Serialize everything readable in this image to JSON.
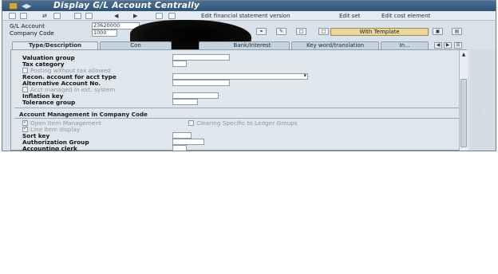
{
  "window": {
    "title": "Display G/L Account Centrally"
  },
  "toolbar": {
    "edit_fs_version": "Edit financial statement version",
    "edit_set": "Edit set",
    "edit_cost_element": "Edit cost element"
  },
  "header": {
    "gl_account_label": "G/L Account",
    "gl_account_value": "23620000",
    "company_code_label": "Company Code",
    "company_code_value": "1000",
    "with_template_label": "With Template"
  },
  "tabs": [
    {
      "label": "Type/Description"
    },
    {
      "label": "Con"
    },
    {
      "label": "Bank/Interest"
    },
    {
      "label": "Key word/translation"
    },
    {
      "label": "In..."
    }
  ],
  "section1": {
    "valuation_group": "Valuation group",
    "tax_category": "Tax category",
    "posting_without_tax": "Posting without tax allowed",
    "recon_account": "Recon. account for acct type",
    "alternative_account": "Alternative Account No.",
    "acct_managed_ext": "Acct managed in ext. system",
    "inflation_key": "Inflation key",
    "tolerance_group": "Tolerance group"
  },
  "section2": {
    "title": "Account Management in Company Code",
    "open_item_mgmt": "Open Item Management",
    "clearing_specific": "Clearing Specific to Ledger Groups",
    "line_item_display": "Line item display",
    "sort_key": "Sort key",
    "authorization_group": "Authorization Group",
    "accounting_clerk": "Accounting clerk"
  },
  "colors": {
    "title_bar": "#3a6086",
    "panel": "#dfe6ec",
    "template_button": "#e9d99b"
  }
}
